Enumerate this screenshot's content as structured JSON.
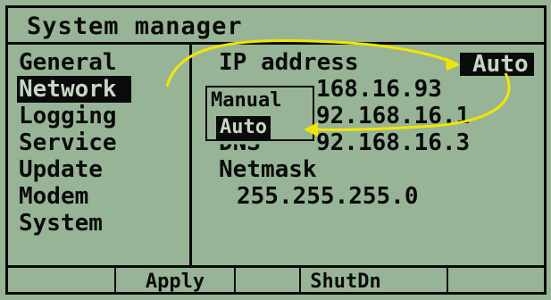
{
  "title": "System manager",
  "menu": [
    {
      "label": "General",
      "selected": false
    },
    {
      "label": "Network",
      "selected": true
    },
    {
      "label": "Logging",
      "selected": false
    },
    {
      "label": "Service",
      "selected": false
    },
    {
      "label": "Update",
      "selected": false
    },
    {
      "label": "Modem",
      "selected": false
    },
    {
      "label": "System",
      "selected": false
    }
  ],
  "content": {
    "ip_label": "IP address",
    "ip_value_partial": "168.16.93",
    "gateway_value_partial": "92.168.16.1",
    "dns_label_partial": "DNS",
    "dns_value_partial": "92.168.16.3",
    "netmask_label": "Netmask",
    "netmask_value": "255.255.255.0",
    "auto_badge": "Auto"
  },
  "dropdown": {
    "options": [
      "Manual",
      "Auto"
    ],
    "selected": "Auto"
  },
  "softkeys": [
    "Apply",
    "ShutDn"
  ],
  "colors": {
    "lcd_background": "#98b496",
    "ink": "#0b0b0b",
    "annotation_arrow": "#f2e600"
  }
}
